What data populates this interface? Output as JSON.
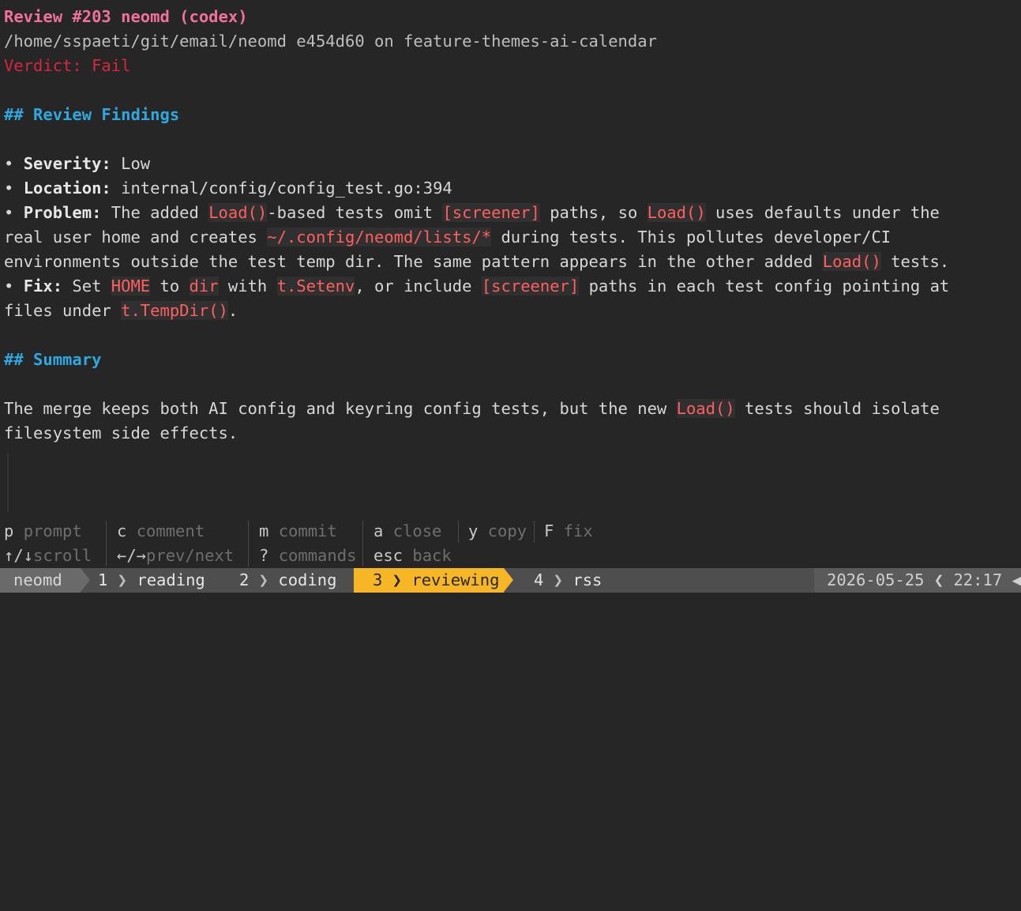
{
  "review": {
    "title": "Review #203 neomd (codex)",
    "path_line": "/home/sspaeti/git/email/neomd e454d60 on feature-themes-ai-calendar",
    "verdict": "Verdict: Fail",
    "findings_heading": "## Review Findings",
    "severity_label": "Severity:",
    "severity_value": "Low",
    "location_label": "Location:",
    "location_value": "internal/config/config_test.go:394",
    "problem_label": "Problem:",
    "problem": {
      "t1": "The added ",
      "c1": "Load()",
      "t2": "-based tests omit ",
      "c2": "[screener]",
      "t3": " paths, so ",
      "c3": "Load()",
      "t4": " uses defaults under the",
      "t5": "real user home and creates ",
      "c4": "~/.config/neomd/lists/*",
      "t6": " during tests. This pollutes developer/CI",
      "t7": "environments outside the test temp dir. The same pattern appears in the other added ",
      "c5": "Load()",
      "t8": " tests."
    },
    "fix_label": "Fix:",
    "fix": {
      "t1": "Set ",
      "c1": "HOME",
      "t2": " to ",
      "c2": "dir",
      "t3": " with ",
      "c3": "t.Setenv",
      "t4": ", or include ",
      "c4": "[screener]",
      "t5": " paths in each test config pointing at",
      "t6": "files under ",
      "c5": "t.TempDir()",
      "t7": "."
    },
    "summary_heading": "## Summary",
    "summary": {
      "t1": "The merge keeps both AI config and keyring config tests, but the new ",
      "c1": "Load()",
      "t2": " tests should isolate",
      "t3": "filesystem side effects."
    }
  },
  "help": {
    "col1": [
      {
        "key": "p",
        "desc": "prompt"
      },
      {
        "key": "↑/↓",
        "desc": "scroll"
      }
    ],
    "col2": [
      {
        "key": "c",
        "desc": "comment"
      },
      {
        "key": "←/→",
        "desc": "prev/next"
      }
    ],
    "col3": [
      {
        "key": "m",
        "desc": "commit"
      },
      {
        "key": "?",
        "desc": "commands"
      }
    ],
    "col4": [
      {
        "key": "a",
        "desc": "close"
      },
      {
        "key": "esc",
        "desc": "back"
      }
    ],
    "col5": [
      {
        "key": "y",
        "desc": "copy"
      }
    ],
    "col6": [
      {
        "key": "F",
        "desc": "fix"
      }
    ]
  },
  "tmux": {
    "session": "neomd",
    "windows": [
      {
        "index": "1",
        "name": "reading"
      },
      {
        "index": "2",
        "name": "coding"
      },
      {
        "index": "3",
        "name": "reviewing"
      },
      {
        "index": "4",
        "name": "rss"
      }
    ],
    "active_window": "3",
    "date": "2026-05-25",
    "time": "22:17",
    "active_color": "#f6b626"
  }
}
